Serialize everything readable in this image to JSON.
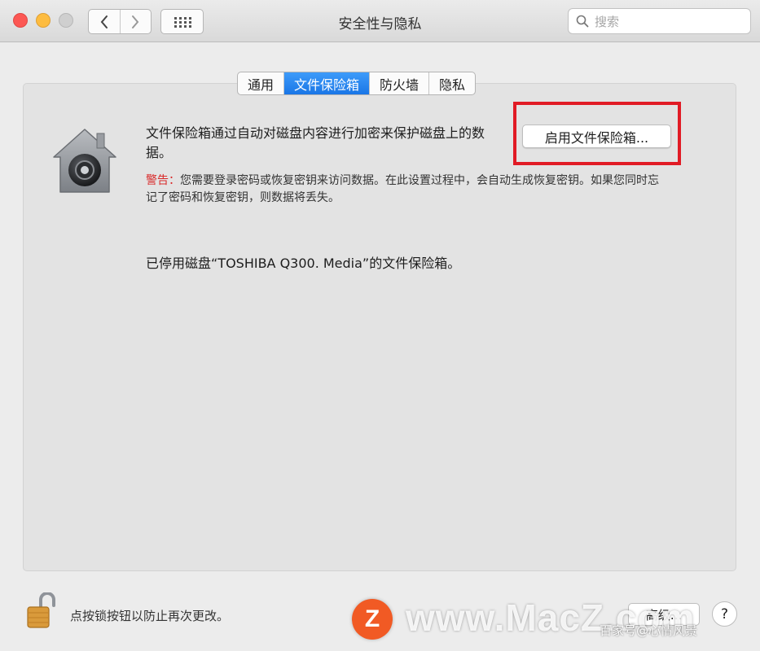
{
  "window": {
    "title": "安全性与隐私",
    "search_placeholder": "搜索"
  },
  "tabs": [
    {
      "label": "通用",
      "active": false
    },
    {
      "label": "文件保险箱",
      "active": true
    },
    {
      "label": "防火墙",
      "active": false
    },
    {
      "label": "隐私",
      "active": false
    }
  ],
  "filevault": {
    "description": "文件保险箱通过自动对磁盘内容进行加密来保护磁盘上的数据。",
    "enable_button": "启用文件保险箱...",
    "warning_label": "警告：",
    "warning_text": "您需要登录密码或恢复密钥来访问数据。在此设置过程中，会自动生成恢复密钥。如果您同时忘记了密码和恢复密钥，则数据将丢失。",
    "status": "已停用磁盘“TOSHIBA Q300. Media”的文件保险箱。"
  },
  "footer": {
    "lock_text": "点按锁按钮以防止再次更改。",
    "advanced_button": "高级...",
    "help_button": "?"
  },
  "watermark": {
    "logo": "Z",
    "text": "www.MacZ.com",
    "small": "百家号@心情风景"
  },
  "colors": {
    "accent": "#1a76e6",
    "highlight": "#e11b25",
    "warning": "#d92b2b"
  },
  "icons": [
    "chevron-left-icon",
    "chevron-right-icon",
    "grid-icon",
    "search-icon",
    "filevault-house-icon",
    "lock-icon"
  ]
}
